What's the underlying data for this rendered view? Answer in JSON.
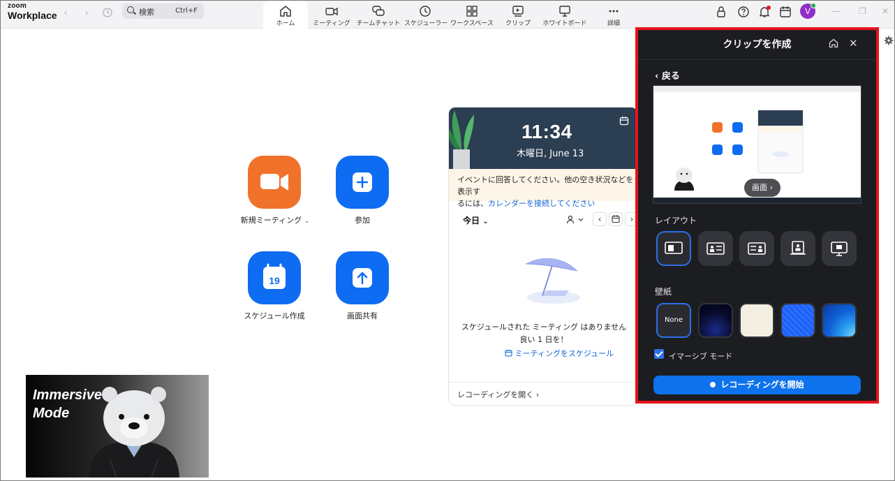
{
  "app": {
    "logo_top": "zoom",
    "logo_bottom": "Workplace"
  },
  "search": {
    "label": "検索",
    "shortcut": "Ctrl+F"
  },
  "tabs": [
    {
      "label": "ホーム",
      "icon": "home-icon",
      "active": true
    },
    {
      "label": "ミーティング",
      "icon": "video-camera-icon"
    },
    {
      "label": "チームチャット",
      "icon": "chat-bubbles-icon"
    },
    {
      "label": "スケジューラー",
      "icon": "clock-icon"
    },
    {
      "label": "ワークスペース",
      "icon": "grid-icon"
    },
    {
      "label": "クリップ",
      "icon": "clip-play-icon"
    },
    {
      "label": "ホワイトボード",
      "icon": "whiteboard-icon"
    },
    {
      "label": "詳細",
      "icon": "more-dots-icon"
    }
  ],
  "user": {
    "avatar_initial": "V"
  },
  "home": {
    "actions": [
      {
        "label": "新規ミーティング",
        "icon": "video-camera-icon",
        "color": "#f0722a"
      },
      {
        "label": "参加",
        "icon": "plus-icon",
        "color": "#0d6cf2"
      },
      {
        "label": "スケジュール作成",
        "icon": "calendar-icon",
        "calendar_day": "19",
        "color": "#0d6cf2"
      },
      {
        "label": "画面共有",
        "icon": "upload-arrow-icon",
        "color": "#0d6cf2"
      }
    ]
  },
  "calendar_card": {
    "time": "11:34",
    "date": "木曜日, June 13",
    "notice_line1": "イベントに回答してください。他の空き状況などを表示す",
    "notice_line2_prefix": "るには、",
    "notice_link": "カレンダーを接続してください",
    "today_label": "今日",
    "empty_line1": "スケジュールされた ミーティング はありません",
    "empty_line2": "良い 1 日を！",
    "schedule_link": "ミーティングをスケジュール",
    "open_recordings": "レコーディングを開く"
  },
  "video_tile": {
    "line1": "Immersive",
    "line2": "Mode"
  },
  "clip_panel": {
    "title": "クリップを作成",
    "back": "戻る",
    "preview_source": "画面",
    "layout_label": "レイアウト",
    "layouts": [
      "layout-camera-left-icon",
      "layout-camera-side-icon",
      "layout-camera-right-icon",
      "layout-camera-center-icon",
      "layout-camera-top-icon"
    ],
    "wallpaper_label": "壁紙",
    "wallpapers": [
      {
        "label": "None"
      },
      {
        "name": "dark-navy",
        "color": "#0a1033"
      },
      {
        "name": "cream",
        "color": "#f3efe2"
      },
      {
        "name": "blue-pattern",
        "color": "#1c5ff2"
      },
      {
        "name": "blue-waves",
        "color": "#1e86e8"
      }
    ],
    "immersive_label": "イマーシブ モード",
    "immersive_checked": true,
    "record_button": "レコーディングを開始",
    "highlight_color": "#e8121b",
    "accent_color": "#0e72ed"
  }
}
